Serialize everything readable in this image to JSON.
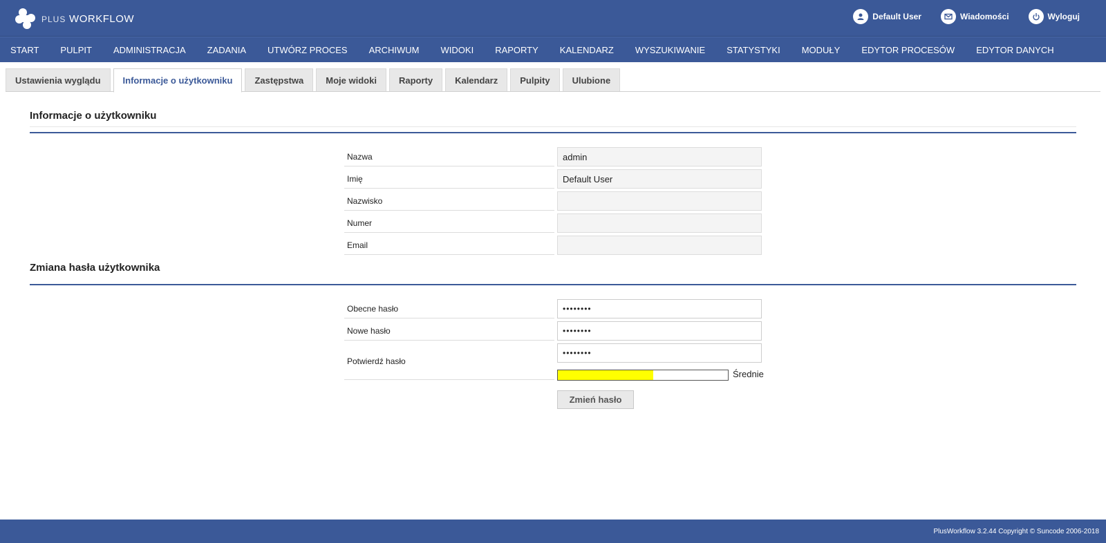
{
  "brand": {
    "light": "PLUS",
    "bold": "WORKFLOW",
    "icon": "plusworkflow-logo-icon"
  },
  "colors": {
    "primary": "#3b5998",
    "strength": "#ffff00"
  },
  "header": {
    "user_label": "Default User",
    "messages_label": "Wiadomości",
    "logout_label": "Wyloguj"
  },
  "nav": {
    "items": [
      "START",
      "PULPIT",
      "ADMINISTRACJA",
      "ZADANIA",
      "UTWÓRZ PROCES",
      "ARCHIWUM",
      "WIDOKI",
      "RAPORTY",
      "KALENDARZ",
      "WYSZUKIWANIE",
      "STATYSTYKI",
      "MODUŁY",
      "EDYTOR PROCESÓW",
      "EDYTOR DANYCH"
    ]
  },
  "tabs": {
    "items": [
      "Ustawienia wyglądu",
      "Informacje o użytkowniku",
      "Zastępstwa",
      "Moje widoki",
      "Raporty",
      "Kalendarz",
      "Pulpity",
      "Ulubione"
    ],
    "active": "Informacje o użytkowniku"
  },
  "user_info": {
    "title": "Informacje o użytkowniku",
    "rows": [
      {
        "label": "Nazwa",
        "value": "admin"
      },
      {
        "label": "Imię",
        "value": "Default User"
      },
      {
        "label": "Nazwisko",
        "value": ""
      },
      {
        "label": "Numer",
        "value": ""
      },
      {
        "label": "Email",
        "value": ""
      }
    ]
  },
  "password": {
    "title": "Zmiana hasła użytkownika",
    "current_label": "Obecne hasło",
    "current_value": "••••••••",
    "new_label": "Nowe hasło",
    "new_value": "••••••••",
    "confirm_label": "Potwierdź hasło",
    "confirm_value": "••••••••",
    "strength_label": "Średnie",
    "strength_fraction": 0.56,
    "submit_label": "Zmień hasło"
  },
  "footer": {
    "text": "PlusWorkflow 3.2.44 Copyright © Suncode 2006-2018"
  }
}
